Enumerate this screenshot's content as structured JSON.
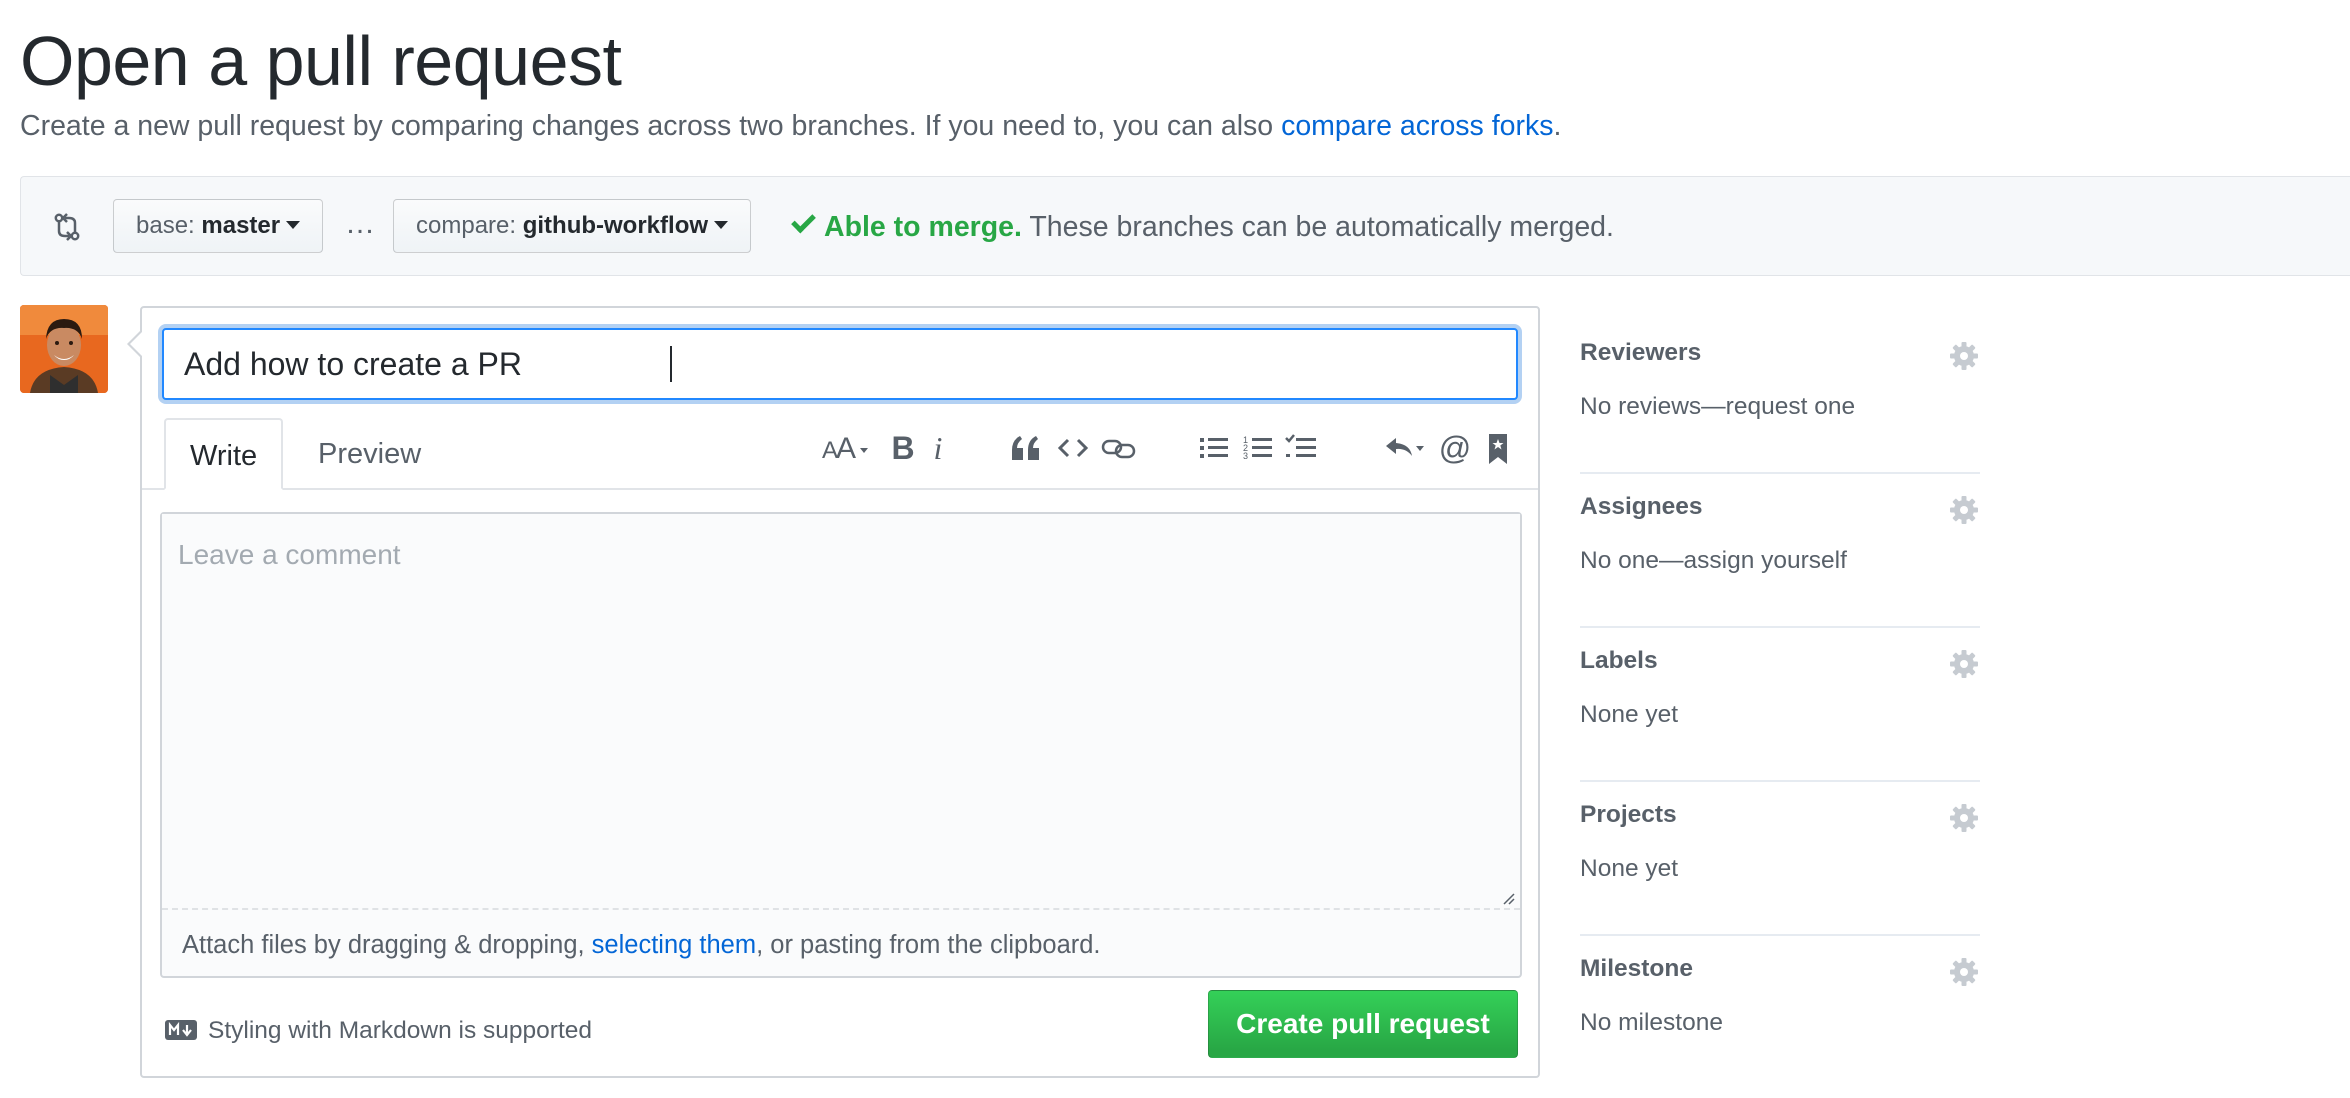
{
  "header": {
    "title": "Open a pull request",
    "subtitle_prefix": "Create a new pull request by comparing changes across two branches. If you need to, you can also ",
    "subtitle_link": "compare across forks",
    "subtitle_suffix": "."
  },
  "range": {
    "base_prefix": "base: ",
    "base_branch": "master",
    "separator": "…",
    "compare_prefix": "compare: ",
    "compare_branch": "github-workflow",
    "merge_ok": "Able to merge.",
    "merge_text": " These branches can be automatically merged."
  },
  "composer": {
    "title_value": "Add how to create a PR",
    "tabs": [
      {
        "label": "Write"
      },
      {
        "label": "Preview"
      }
    ],
    "toolbar": {
      "header_icon": "text-size-icon",
      "bold": "B",
      "italic": "i",
      "mention": "@"
    },
    "comment_placeholder": "Leave a comment",
    "attach_prefix": "Attach files by dragging & dropping, ",
    "attach_link": "selecting them",
    "attach_suffix": ", or pasting from the clipboard.",
    "markdown_note": "Styling with Markdown is supported",
    "submit_label": "Create pull request"
  },
  "sidebar": {
    "sections": [
      {
        "heading": "Reviewers",
        "value": "No reviews—request one"
      },
      {
        "heading": "Assignees",
        "value": "No one—assign yourself"
      },
      {
        "heading": "Labels",
        "value": "None yet"
      },
      {
        "heading": "Projects",
        "value": "None yet"
      },
      {
        "heading": "Milestone",
        "value": "No milestone"
      }
    ]
  },
  "colors": {
    "accent": "#0366d6",
    "success": "#28a745",
    "avatar_bg": "#e8681f"
  }
}
